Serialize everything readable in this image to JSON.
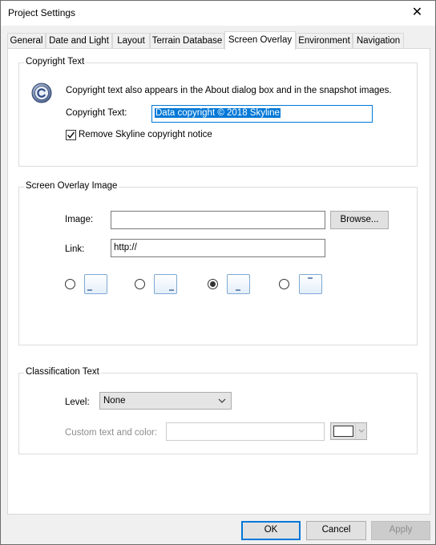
{
  "window": {
    "title": "Project Settings",
    "close_glyph": "✕"
  },
  "tabs": [
    {
      "label": "General"
    },
    {
      "label": "Date and Light"
    },
    {
      "label": "Layout"
    },
    {
      "label": "Terrain Database"
    },
    {
      "label": "Screen Overlay"
    },
    {
      "label": "Environment"
    },
    {
      "label": "Navigation"
    }
  ],
  "active_tab": "Screen Overlay",
  "copyright": {
    "group_label": "Copyright Text",
    "info": "Copyright text also appears in the About dialog box and in the snapshot images.",
    "text_label": "Copyright Text:",
    "text_value": "Data copyright © 2018 Skyline",
    "checkbox_label": "Remove Skyline copyright notice",
    "checkbox_checked": true,
    "icon": "copyright-icon"
  },
  "overlay": {
    "group_label": "Screen Overlay Image",
    "image_label": "Image:",
    "image_value": "",
    "browse_label": "Browse...",
    "link_label": "Link:",
    "link_value": "http://",
    "positions": [
      "bottom-left",
      "bottom-right",
      "bottom-center",
      "top-center"
    ],
    "selected_position": "bottom-center"
  },
  "classification": {
    "group_label": "Classification Text",
    "level_label": "Level:",
    "level_value": "None",
    "custom_label": "Custom text and color:",
    "custom_value": "",
    "color": "#ffffff"
  },
  "buttons": {
    "ok": "OK",
    "cancel": "Cancel",
    "apply": "Apply"
  }
}
